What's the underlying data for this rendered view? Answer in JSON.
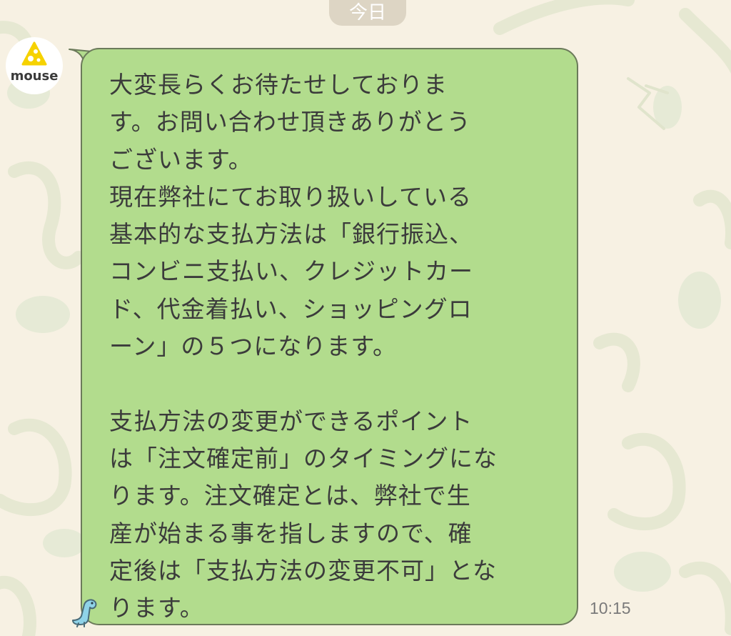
{
  "chat": {
    "date_label": "今日",
    "sender": {
      "avatar_label": "mouse",
      "avatar_icon": "cheese-logo-icon",
      "brand_color": "#f6d200"
    },
    "message": {
      "text": "大変長らくお待たせしておりま\nす。お問い合わせ頂きありがとう\nございます。\n現在弊社にてお取り扱いしている\n基本的な支払方法は「銀行振込、\nコンビニ支払い、クレジットカー\nド、代金着払い、ショッピングロ\nーン」の５つになります。\n\n支払方法の変更ができるポイント\nは「注文確定前」のタイミングにな\nります。注文確定とは、弊社で生\n産が始まる事を指しますので、確\n定後は「支払方法の変更不可」とな\nります。",
      "time": "10:15",
      "bubble_color": "#b2dc8d"
    },
    "sticker_icon": "dinosaur-sticker-icon"
  }
}
